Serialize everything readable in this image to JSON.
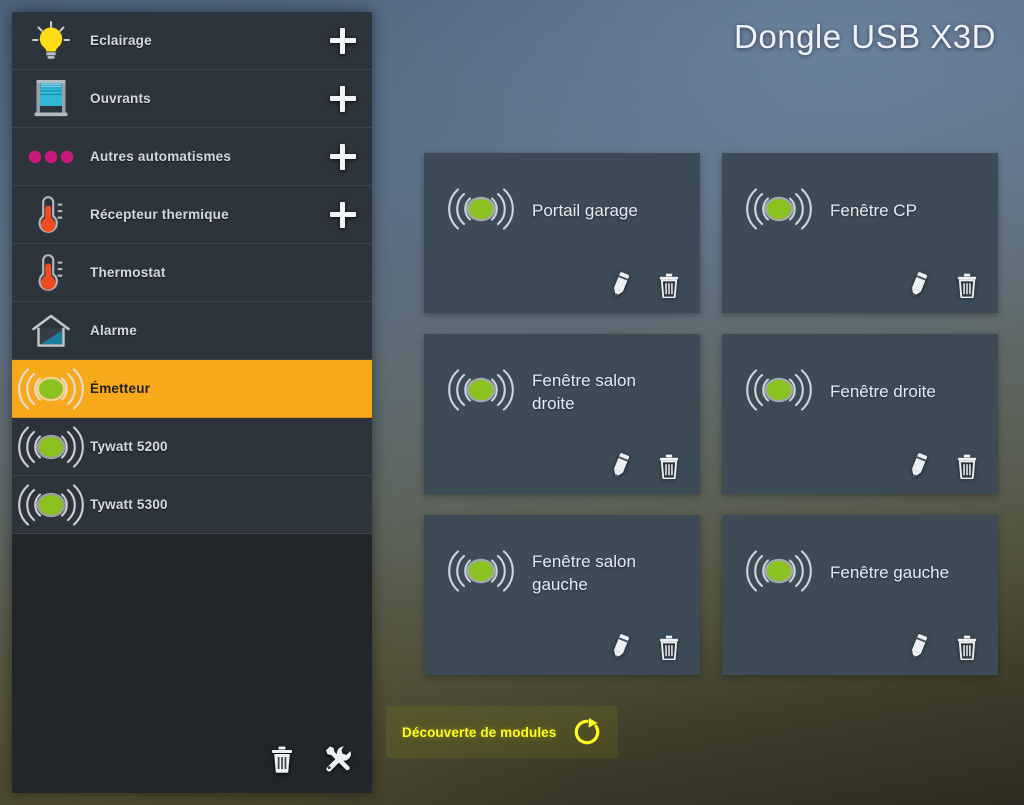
{
  "header": {
    "title": "Dongle USB X3D"
  },
  "sidebar": {
    "items": [
      {
        "label": "Eclairage",
        "icon": "lightbulb-icon",
        "add": true,
        "selected": false
      },
      {
        "label": "Ouvrants",
        "icon": "shutter-icon",
        "add": true,
        "selected": false
      },
      {
        "label": "Autres automatismes",
        "icon": "three-dots-icon",
        "add": true,
        "selected": false
      },
      {
        "label": "Récepteur thermique",
        "icon": "thermometer-icon",
        "add": true,
        "selected": false
      },
      {
        "label": "Thermostat",
        "icon": "thermometer-icon",
        "add": false,
        "selected": false
      },
      {
        "label": "Alarme",
        "icon": "house-alarm-icon",
        "add": false,
        "selected": false
      },
      {
        "label": "Émetteur",
        "icon": "transmitter-icon",
        "add": false,
        "selected": true
      },
      {
        "label": "Tywatt 5200",
        "icon": "transmitter-icon",
        "add": false,
        "selected": false
      },
      {
        "label": "Tywatt 5300",
        "icon": "transmitter-icon",
        "add": false,
        "selected": false
      }
    ],
    "footer": [
      {
        "name": "delete-all-button",
        "icon": "trash-icon"
      },
      {
        "name": "tools-button",
        "icon": "tools-icon"
      }
    ]
  },
  "main": {
    "cards": [
      {
        "title": "Portail garage",
        "icon": "transmitter-icon",
        "edit": "edit-icon",
        "delete": "trash-icon"
      },
      {
        "title": "Fenêtre CP",
        "icon": "transmitter-icon",
        "edit": "edit-icon",
        "delete": "trash-icon"
      },
      {
        "title": "Fenêtre salon droite",
        "icon": "transmitter-icon",
        "edit": "edit-icon",
        "delete": "trash-icon"
      },
      {
        "title": "Fenêtre droite",
        "icon": "transmitter-icon",
        "edit": "edit-icon",
        "delete": "trash-icon"
      },
      {
        "title": "Fenêtre salon gauche",
        "icon": "transmitter-icon",
        "edit": "edit-icon",
        "delete": "trash-icon"
      },
      {
        "title": "Fenêtre gauche",
        "icon": "transmitter-icon",
        "edit": "edit-icon",
        "delete": "trash-icon"
      }
    ]
  },
  "discovery": {
    "label": "Découverte de modules",
    "icon": "refresh-icon"
  },
  "colors": {
    "accent": "#f7a81b",
    "card_bg": "#3c4b56",
    "sidebar_bg": "#2d343c",
    "transmitter_green": "#8cc220",
    "discovery_yellow": "#fdfd22",
    "thermometer_red": "#f04a23",
    "dots_magenta": "#c9197d",
    "shutter_cyan": "#2fb8d4",
    "alarm_teal": "#1d7fa0",
    "bulb_yellow": "#ffdd16"
  }
}
